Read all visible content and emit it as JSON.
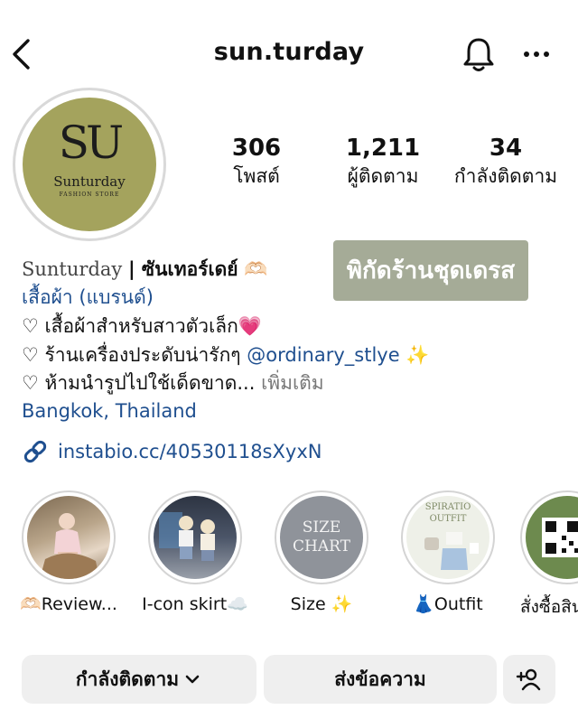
{
  "header": {
    "username": "sun.turday",
    "back_icon": "chevron-left-icon",
    "notification_icon": "bell-icon",
    "more_icon": "more-horizontal-icon"
  },
  "avatar": {
    "monogram": "SU",
    "brand": "Sunturday",
    "subtitle": "FASHION STORE"
  },
  "stats": [
    {
      "value": "306",
      "label": "โพสต์"
    },
    {
      "value": "1,211",
      "label": "ผู้ติดตาม"
    },
    {
      "value": "34",
      "label": "กำลังติดตาม"
    }
  ],
  "store_tag": "พิกัดร้านชุดเดรส",
  "bio": {
    "name_latin": "Sunturday",
    "name_thai": "| ซันเทอร์เดย์",
    "name_emoji": "🫶🏻",
    "category": "เสื้อผ้า (แบรนด์)",
    "line1": "♡ เสื้อผ้าสำหรับสาวตัวเล็ก",
    "line1_emoji": "💗",
    "line2": "♡ ร้านเครื่องประดับน่ารักๆ",
    "line2_mention": "@ordinary_stlye",
    "line2_emoji": "✨",
    "line3": "♡ ห้ามนำรูปไปใช้เด็ดขาด...",
    "more_label": "เพิ่มเติม",
    "location": "Bangkok, Thailand",
    "link": "instabio.cc/40530118sXyxN",
    "link_icon": "link-icon"
  },
  "highlights": [
    {
      "label": "🫶🏻Review...",
      "thumb_text": ""
    },
    {
      "label": "I-con skirt☁️",
      "thumb_text": ""
    },
    {
      "label": "Size ✨",
      "thumb_text": "SIZE CHART"
    },
    {
      "label": "👗Outfit",
      "thumb_text": "SPIRATIO OUTFIT"
    },
    {
      "label": "สั่งซื้อสิน",
      "thumb_text": ""
    }
  ],
  "actions": {
    "following_label": "กำลังติดตาม",
    "following_icon": "chevron-down-icon",
    "message_label": "ส่งข้อความ",
    "add_user_icon": "add-user-icon"
  },
  "colors": {
    "link": "#1f4f8f",
    "avatar_bg": "#a4a35d",
    "tag_bg": "#a5ab97",
    "button_bg": "#efefef"
  }
}
